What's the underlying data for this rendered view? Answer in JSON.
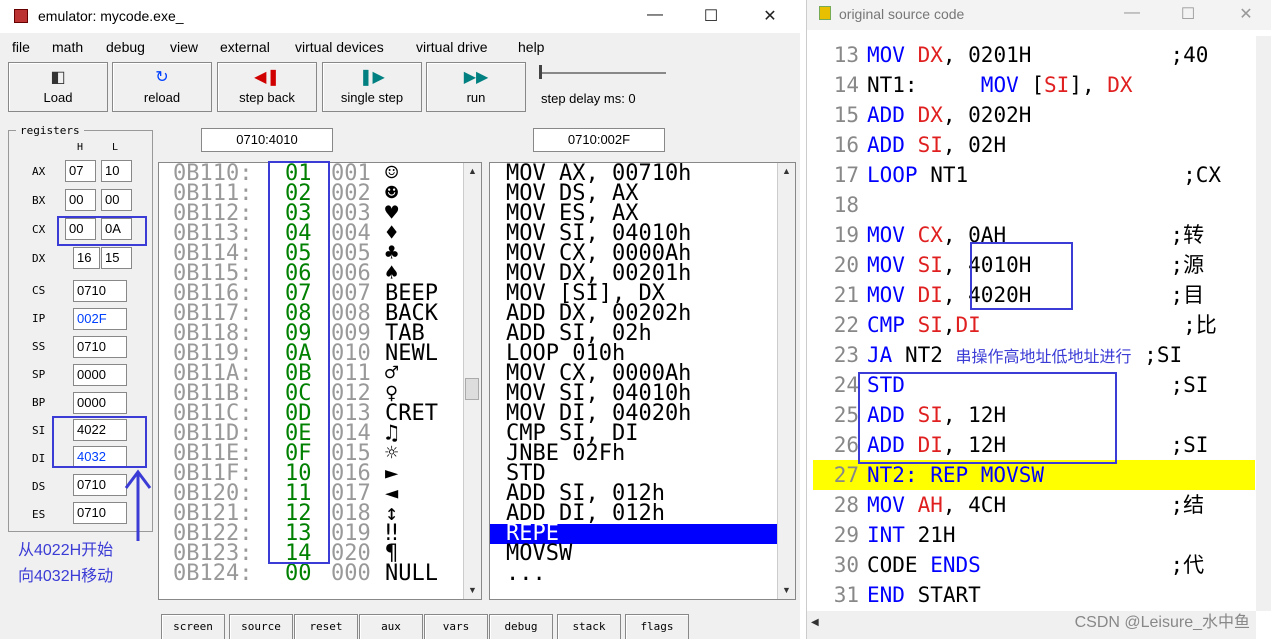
{
  "emulator": {
    "title": "emulator: mycode.exe_",
    "menu": [
      "file",
      "math",
      "debug",
      "view",
      "external",
      "virtual devices",
      "virtual drive",
      "help"
    ],
    "toolbar": {
      "load": "Load",
      "reload": "reload",
      "step_back": "step back",
      "single_step": "single step",
      "run": "run",
      "step_delay": "step delay ms: 0"
    },
    "registers": {
      "title": "registers",
      "h": "H",
      "l": "L",
      "AX": {
        "h": "07",
        "l": "10"
      },
      "BX": {
        "h": "00",
        "l": "00"
      },
      "CX": {
        "h": "00",
        "l": "0A"
      },
      "DX": {
        "h": "16",
        "l": "15"
      },
      "CS": "0710",
      "IP": "002F",
      "SS": "0710",
      "SP": "0000",
      "BP": "0000",
      "SI": "4022",
      "DI": "4032",
      "DS": "0710",
      "ES": "0710"
    },
    "mem_address": "0710:4010",
    "dis_address": "0710:002F",
    "memory": [
      {
        "addr": "0B110:",
        "hex": "01",
        "dec": "001",
        "chr": "☺"
      },
      {
        "addr": "0B111:",
        "hex": "02",
        "dec": "002",
        "chr": "☻"
      },
      {
        "addr": "0B112:",
        "hex": "03",
        "dec": "003",
        "chr": "♥"
      },
      {
        "addr": "0B113:",
        "hex": "04",
        "dec": "004",
        "chr": "♦"
      },
      {
        "addr": "0B114:",
        "hex": "05",
        "dec": "005",
        "chr": "♣"
      },
      {
        "addr": "0B115:",
        "hex": "06",
        "dec": "006",
        "chr": "♠"
      },
      {
        "addr": "0B116:",
        "hex": "07",
        "dec": "007",
        "chr": "BEEP"
      },
      {
        "addr": "0B117:",
        "hex": "08",
        "dec": "008",
        "chr": "BACK"
      },
      {
        "addr": "0B118:",
        "hex": "09",
        "dec": "009",
        "chr": "TAB"
      },
      {
        "addr": "0B119:",
        "hex": "0A",
        "dec": "010",
        "chr": "NEWL"
      },
      {
        "addr": "0B11A:",
        "hex": "0B",
        "dec": "011",
        "chr": "♂"
      },
      {
        "addr": "0B11B:",
        "hex": "0C",
        "dec": "012",
        "chr": "♀"
      },
      {
        "addr": "0B11C:",
        "hex": "0D",
        "dec": "013",
        "chr": "CRET"
      },
      {
        "addr": "0B11D:",
        "hex": "0E",
        "dec": "014",
        "chr": "♫"
      },
      {
        "addr": "0B11E:",
        "hex": "0F",
        "dec": "015",
        "chr": "☼"
      },
      {
        "addr": "0B11F:",
        "hex": "10",
        "dec": "016",
        "chr": "►"
      },
      {
        "addr": "0B120:",
        "hex": "11",
        "dec": "017",
        "chr": "◄"
      },
      {
        "addr": "0B121:",
        "hex": "12",
        "dec": "018",
        "chr": "↕"
      },
      {
        "addr": "0B122:",
        "hex": "13",
        "dec": "019",
        "chr": "‼"
      },
      {
        "addr": "0B123:",
        "hex": "14",
        "dec": "020",
        "chr": "¶"
      },
      {
        "addr": "0B124:",
        "hex": "00",
        "dec": "000",
        "chr": "NULL"
      }
    ],
    "disassembly": [
      "MOV AX, 00710h",
      "MOV DS, AX",
      "MOV ES, AX",
      "MOV SI, 04010h",
      "MOV CX, 0000Ah",
      "MOV DX, 00201h",
      "MOV [SI], DX",
      "ADD DX, 00202h",
      "ADD SI, 02h",
      "LOOP 010h",
      "MOV CX, 0000Ah",
      "MOV SI, 04010h",
      "MOV DI, 04020h",
      "CMP SI, DI",
      "JNBE 02Fh",
      "STD",
      "ADD SI, 012h",
      "ADD DI, 012h",
      "REPE",
      "MOVSW",
      "..."
    ],
    "bottom_buttons": [
      "screen",
      "source",
      "reset",
      "aux",
      "vars",
      "debug",
      "stack",
      "flags"
    ],
    "annotation": "从4022H开始\n向4032H移动"
  },
  "source": {
    "title": "original source code",
    "lines": [
      {
        "n": "13",
        "parts": [
          {
            "t": "MOV ",
            "c": "kw"
          },
          {
            "t": "DX",
            "c": "rg"
          },
          {
            "t": ", 0201H",
            "c": "tx"
          },
          {
            "t": "           ;40",
            "c": "cm"
          }
        ]
      },
      {
        "n": "14",
        "parts": [
          {
            "t": "NT1:     ",
            "c": "tx"
          },
          {
            "t": "MOV ",
            "c": "kw"
          },
          {
            "t": "[",
            "c": "tx"
          },
          {
            "t": "SI",
            "c": "rg"
          },
          {
            "t": "], ",
            "c": "tx"
          },
          {
            "t": "DX",
            "c": "rg"
          }
        ]
      },
      {
        "n": "15",
        "parts": [
          {
            "t": "ADD ",
            "c": "kw"
          },
          {
            "t": "DX",
            "c": "rg"
          },
          {
            "t": ", 0202H",
            "c": "tx"
          }
        ]
      },
      {
        "n": "16",
        "parts": [
          {
            "t": "ADD ",
            "c": "kw"
          },
          {
            "t": "SI",
            "c": "rg"
          },
          {
            "t": ", 02H",
            "c": "tx"
          }
        ]
      },
      {
        "n": "17",
        "parts": [
          {
            "t": "LOOP ",
            "c": "kw"
          },
          {
            "t": "NT1",
            "c": "tx"
          },
          {
            "t": "                 ;CX",
            "c": "cm"
          }
        ]
      },
      {
        "n": "18",
        "parts": []
      },
      {
        "n": "19",
        "parts": [
          {
            "t": "MOV ",
            "c": "kw"
          },
          {
            "t": "CX",
            "c": "rg"
          },
          {
            "t": ", 0AH",
            "c": "tx"
          },
          {
            "t": "             ;转",
            "c": "cm"
          }
        ]
      },
      {
        "n": "20",
        "parts": [
          {
            "t": "MOV ",
            "c": "kw"
          },
          {
            "t": "SI",
            "c": "rg"
          },
          {
            "t": ", 4010H",
            "c": "tx"
          },
          {
            "t": "           ;源",
            "c": "cm"
          }
        ]
      },
      {
        "n": "21",
        "parts": [
          {
            "t": "MOV ",
            "c": "kw"
          },
          {
            "t": "DI",
            "c": "rg"
          },
          {
            "t": ", 4020H",
            "c": "tx"
          },
          {
            "t": "           ;目",
            "c": "cm"
          }
        ]
      },
      {
        "n": "22",
        "parts": [
          {
            "t": "CMP ",
            "c": "kw"
          },
          {
            "t": "SI",
            "c": "rg"
          },
          {
            "t": ",",
            "c": "tx"
          },
          {
            "t": "DI",
            "c": "rg"
          },
          {
            "t": "                ;比",
            "c": "cm"
          }
        ]
      },
      {
        "n": "23",
        "parts": [
          {
            "t": "JA ",
            "c": "kw"
          },
          {
            "t": "NT2 ",
            "c": "tx"
          },
          {
            "t": "串操作高地址低地址进行",
            "c": "note"
          },
          {
            "t": " ;SI",
            "c": "cm"
          }
        ]
      },
      {
        "n": "24",
        "parts": [
          {
            "t": "STD",
            "c": "kw"
          },
          {
            "t": "                     ;SI",
            "c": "cm"
          }
        ]
      },
      {
        "n": "25",
        "parts": [
          {
            "t": "ADD ",
            "c": "kw"
          },
          {
            "t": "SI",
            "c": "rg"
          },
          {
            "t": ", 12H",
            "c": "tx"
          }
        ]
      },
      {
        "n": "26",
        "parts": [
          {
            "t": "ADD ",
            "c": "kw"
          },
          {
            "t": "DI",
            "c": "rg"
          },
          {
            "t": ", 12H",
            "c": "tx"
          },
          {
            "t": "             ;SI",
            "c": "cm"
          }
        ]
      },
      {
        "n": "27",
        "parts": [
          {
            "t": "NT2: REP MOVSW",
            "c": "kw"
          }
        ],
        "highlight": true
      },
      {
        "n": "28",
        "parts": [
          {
            "t": "MOV ",
            "c": "kw"
          },
          {
            "t": "AH",
            "c": "rg"
          },
          {
            "t": ", 4CH",
            "c": "tx"
          },
          {
            "t": "             ;结",
            "c": "cm"
          }
        ]
      },
      {
        "n": "29",
        "parts": [
          {
            "t": "INT ",
            "c": "kw"
          },
          {
            "t": "21H",
            "c": "tx"
          }
        ]
      },
      {
        "n": "30",
        "parts": [
          {
            "t": "CODE ",
            "c": "tx"
          },
          {
            "t": "ENDS",
            "c": "kw"
          },
          {
            "t": "               ;代",
            "c": "cm"
          }
        ]
      },
      {
        "n": "31",
        "parts": [
          {
            "t": "END ",
            "c": "kw"
          },
          {
            "t": "START",
            "c": "tx"
          }
        ]
      }
    ],
    "watermark": "CSDN @Leisure_水中鱼"
  },
  "colors": {
    "keyword": "#0000ff",
    "register": "#e02020",
    "hex_bytes": "#008000",
    "annotation": "#3b3bd6",
    "current_line": "#ffff00",
    "selection": "#0000ff"
  }
}
